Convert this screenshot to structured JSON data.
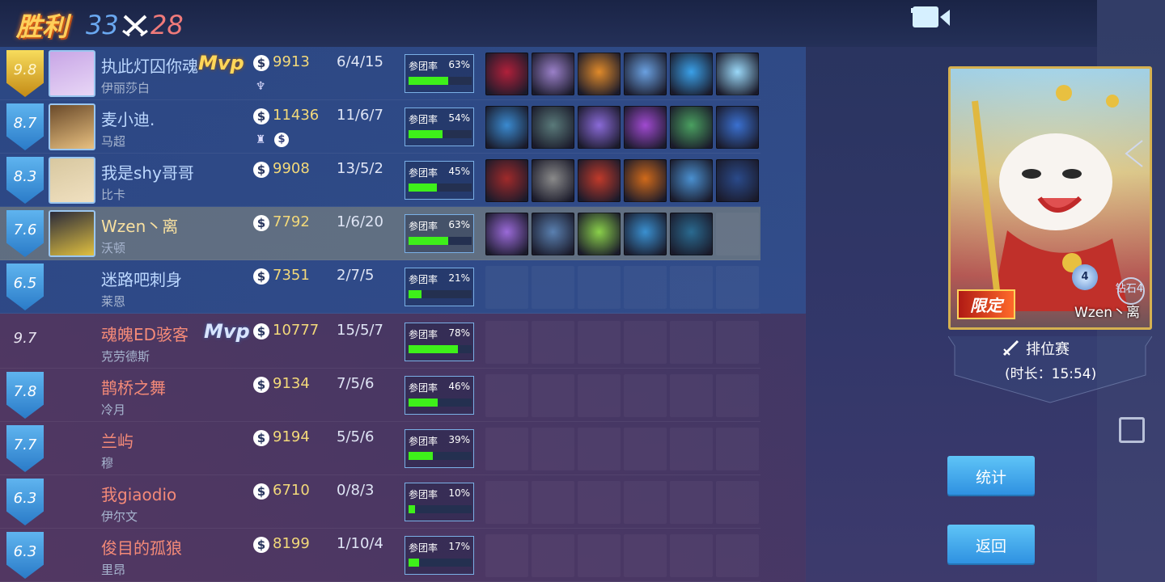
{
  "header": {
    "result": "胜利",
    "score_blue": "33",
    "score_red": "28"
  },
  "blue_team": [
    {
      "rating": "9.8",
      "badge": "gold",
      "name": "执此灯囚你魂",
      "hero": "伊丽莎白",
      "mvp": "Mvp",
      "gold": "9913",
      "kda": "6/4/15",
      "participation_label": "参团率",
      "participation": "63%",
      "participation_value": 0.63,
      "extras": [
        "a-icon"
      ],
      "has_avatar": true,
      "items": 6,
      "avatar_colors": [
        "#c8a6e6",
        "#e8d6f6"
      ],
      "item_colors": [
        "#b0203a",
        "#9a80c8",
        "#e08a2a",
        "#6aa0e0",
        "#3aa0e8",
        "#9ad8f8"
      ]
    },
    {
      "rating": "8.7",
      "badge": "blue",
      "name": "麦小迪.",
      "hero": "马超",
      "gold": "11436",
      "kda": "11/6/7",
      "participation_label": "参团率",
      "participation": "54%",
      "participation_value": 0.54,
      "extras": [
        "tower-icon",
        "coin-icon"
      ],
      "has_avatar": true,
      "items": 6,
      "avatar_colors": [
        "#6a4a2a",
        "#e8c080"
      ],
      "item_colors": [
        "#3a8ad0",
        "#5a7a7a",
        "#8a6ad8",
        "#a04ad0",
        "#4aa060",
        "#3a70d0"
      ]
    },
    {
      "rating": "8.3",
      "badge": "blue",
      "name": "我是shy哥哥",
      "hero": "比卡",
      "gold": "9908",
      "kda": "13/5/2",
      "participation_label": "参团率",
      "participation": "45%",
      "participation_value": 0.45,
      "extras": [],
      "has_avatar": true,
      "items": 6,
      "avatar_colors": [
        "#d8c8a0",
        "#f0e0c0"
      ],
      "item_colors": [
        "#a02a2a",
        "#8a8a8a",
        "#c03a2a",
        "#d06a1a",
        "#4a90d0",
        "#2a4a8a"
      ]
    },
    {
      "rating": "7.6",
      "badge": "blue",
      "name": "Wzen丶离",
      "hero": "沃顿",
      "gold": "7792",
      "kda": "1/6/20",
      "participation_label": "参团率",
      "participation": "63%",
      "participation_value": 0.63,
      "extras": [],
      "has_avatar": true,
      "highlight": true,
      "items": 5,
      "avatar_colors": [
        "#2a2a3a",
        "#e0c040"
      ],
      "item_colors": [
        "#9a6ad8",
        "#5a80b0",
        "#8ad04a",
        "#3a90d0",
        "#2a6a90"
      ]
    },
    {
      "rating": "6.5",
      "badge": "blue",
      "name": "迷路吧刺身",
      "hero": "莱恩",
      "gold": "7351",
      "kda": "2/7/5",
      "participation_label": "参团率",
      "participation": "21%",
      "participation_value": 0.21,
      "extras": [],
      "has_avatar": false,
      "items": 0
    }
  ],
  "red_team": [
    {
      "rating": "9.7",
      "badge": "plain",
      "name": "魂魄ED骇客",
      "hero": "克劳德斯",
      "mvp": "Mvp",
      "gold": "10777",
      "kda": "15/5/7",
      "participation_label": "参团率",
      "participation": "78%",
      "participation_value": 0.78,
      "extras": [],
      "has_avatar": false,
      "items": 0
    },
    {
      "rating": "7.8",
      "badge": "blue",
      "name": "鹊桥之舞",
      "hero": "冷月",
      "gold": "9134",
      "kda": "7/5/6",
      "participation_label": "参团率",
      "participation": "46%",
      "participation_value": 0.46,
      "extras": [],
      "has_avatar": false,
      "items": 0
    },
    {
      "rating": "7.7",
      "badge": "blue",
      "name": "兰屿",
      "hero": "穆",
      "gold": "9194",
      "kda": "5/5/6",
      "participation_label": "参团率",
      "participation": "39%",
      "participation_value": 0.39,
      "extras": [],
      "has_avatar": false,
      "items": 0
    },
    {
      "rating": "6.3",
      "badge": "blue",
      "name": "我giaodio",
      "hero": "伊尔文",
      "gold": "6710",
      "kda": "0/8/3",
      "participation_label": "参团率",
      "participation": "10%",
      "participation_value": 0.1,
      "extras": [],
      "has_avatar": false,
      "items": 0
    },
    {
      "rating": "6.3",
      "badge": "blue",
      "name": "俊目的孤狼",
      "hero": "里昂",
      "gold": "8199",
      "kda": "1/10/4",
      "participation_label": "参团率",
      "participation": "17%",
      "participation_value": 0.17,
      "extras": [],
      "has_avatar": false,
      "items": 0
    }
  ],
  "hero_card": {
    "limited_label": "限定",
    "player_name": "Wzen丶离",
    "rank_label": "钻石4",
    "rank_level": "4"
  },
  "mode": {
    "title": "排位赛",
    "duration": "(时长：15:54)"
  },
  "buttons": {
    "stats": "统计",
    "back": "返回"
  },
  "colors": {
    "participation_bar": "#3ef01a",
    "blue_name": "#bcd8ff",
    "red_name": "#f48a78",
    "gold_text": "#f3d97a"
  }
}
